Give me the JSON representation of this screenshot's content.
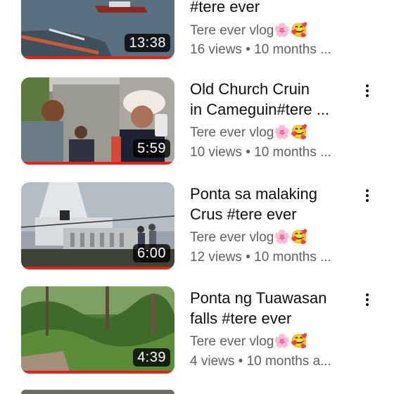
{
  "videos": [
    {
      "title_lines": [
        "",
        "#tere ever"
      ],
      "channel": "Tere ever vlog🌸🥰",
      "meta": "16 views • 10 months ...",
      "duration": "13:38",
      "watch_progress": 1.0
    },
    {
      "title_lines": [
        "Old Church Cruin",
        "in Cameguin#tere ..."
      ],
      "channel": "Tere ever vlog🌸🥰",
      "meta": "10 views • 10 months ...",
      "duration": "5:59",
      "watch_progress": 1.0
    },
    {
      "title_lines": [
        "Ponta sa malaking",
        "Crus #tere ever"
      ],
      "channel": "Tere ever vlog🌸🥰",
      "meta": "12 views • 10 months ...",
      "duration": "6:00",
      "watch_progress": 1.0
    },
    {
      "title_lines": [
        "Ponta ng Tuawasan",
        "falls #tere ever"
      ],
      "channel": "Tere ever vlog🌸🥰",
      "meta": "4 views • 10 months a...",
      "duration": "4:39",
      "watch_progress": 1.0
    }
  ],
  "icons": {
    "menu": "more-vert-icon"
  },
  "colors": {
    "progress": "#e62117",
    "secondary_text": "#606060"
  }
}
